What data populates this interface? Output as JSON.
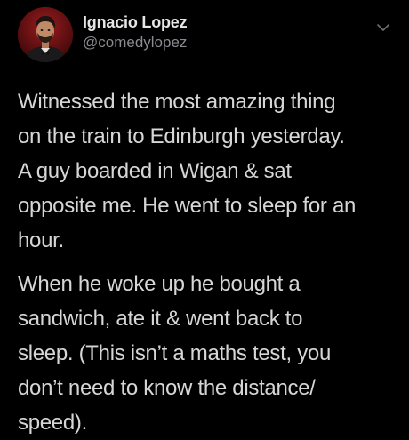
{
  "tweet": {
    "author": {
      "display_name": "Ignacio Lopez",
      "handle": "@comedylopez",
      "avatar_icon": "profile-photo",
      "menu_icon": "chevron-down-icon"
    },
    "paragraphs": [
      "Witnessed the most amazing thing\non the train to Edinburgh yesterday.\nA guy boarded in Wigan & sat\nopposite me. He went to sleep for an\nhour.",
      "When he woke up he bought a\nsandwich, ate it & went back to\nsleep. (This isn’t a maths test, you\ndon’t need to know the distance/\nspeed)."
    ]
  },
  "colors": {
    "background": "#000000",
    "text": "#d6d6d6",
    "secondary_text": "#8a8a8f",
    "avatar_bg": "#5a0f12"
  }
}
